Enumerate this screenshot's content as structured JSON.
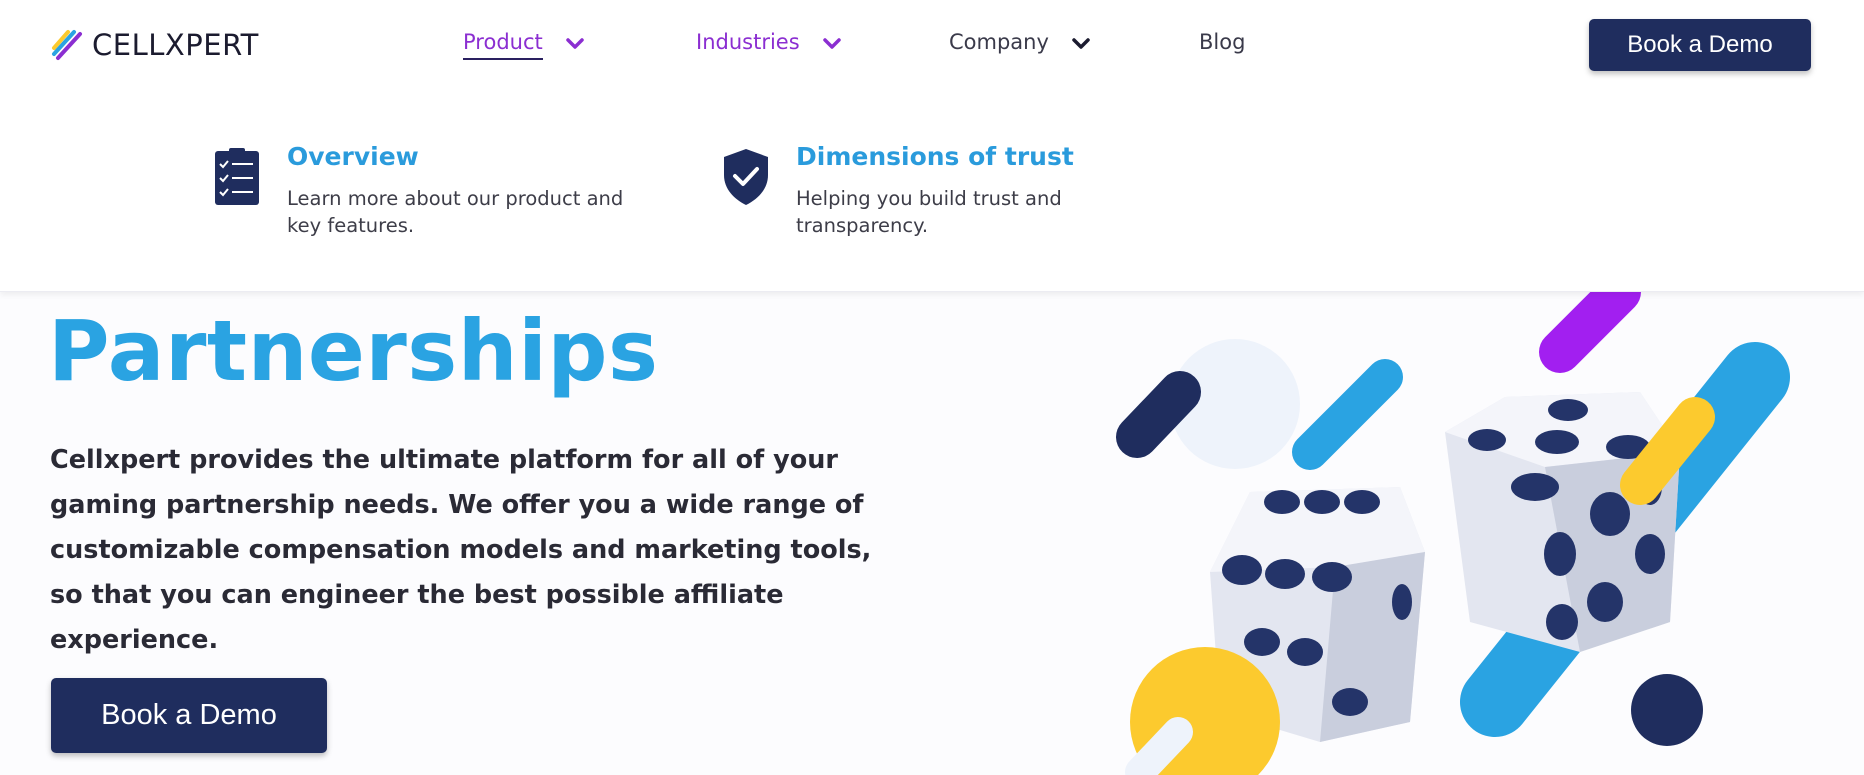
{
  "brand": {
    "name": "CELLXPERT"
  },
  "nav": {
    "items": [
      {
        "label": "Product",
        "has_dropdown": true,
        "active": true
      },
      {
        "label": "Industries",
        "has_dropdown": true
      },
      {
        "label": "Company",
        "has_dropdown": true
      },
      {
        "label": "Blog",
        "has_dropdown": false
      }
    ],
    "cta_label": "Book a Demo"
  },
  "dropdown": {
    "items": [
      {
        "title": "Overview",
        "description": "Learn more about our product and key features.",
        "icon": "checklist-icon"
      },
      {
        "title": "Dimensions of trust",
        "description": "Helping you build trust and transparency.",
        "icon": "shield-check-icon"
      }
    ]
  },
  "hero": {
    "title": "Partnerships",
    "text": "Cellxpert provides the ultimate platform for all of your gaming partnership needs. We offer you a wide range of customizable compensation models and marketing tools, so that you can engineer the best possible affiliate experience.",
    "cta_label": "Book a Demo"
  },
  "colors": {
    "navy": "#1f2d5e",
    "blue": "#2aa3e2",
    "purple": "#8b2ed1",
    "yellow": "#fcca2e"
  }
}
